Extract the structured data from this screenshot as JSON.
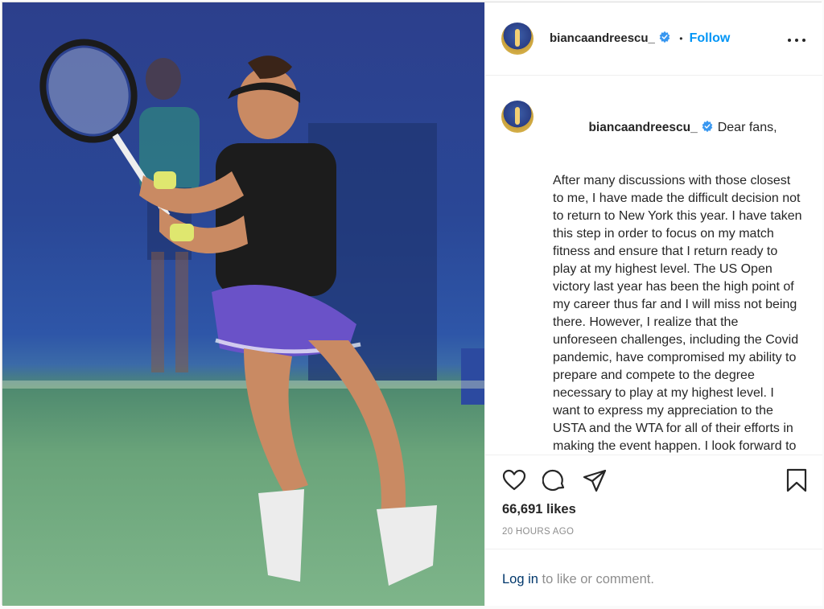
{
  "post": {
    "username": "biancaandreescu_",
    "follow_label": "Follow",
    "separator": "•",
    "caption_greeting": "Dear fans,",
    "caption_body": "After many discussions with those closest to me, I have made the difficult decision not to return to New York this year. I have taken this step in order to focus on my match fitness and ensure that I return ready to play at my highest level. The US Open victory last year has been the high point of my career thus far and I will miss not being there. However, I realize that the unforeseen challenges, including the Covid pandemic, have compromised my ability to prepare and compete to the degree necessary to play at my highest level. I want to express my appreciation to the USTA and the WTA for all of their efforts in making the event happen. I look forward to",
    "likes": "66,691 likes",
    "timestamp": "20 HOURS AGO",
    "login_link": "Log in",
    "login_suffix": " to like or comment."
  },
  "icons": {
    "verified": "verified-badge-icon",
    "more": "more-options-icon",
    "like": "heart-icon",
    "comment": "comment-icon",
    "share": "share-icon",
    "save": "bookmark-icon"
  },
  "colors": {
    "accent": "#0095f6",
    "link": "#00376b",
    "muted": "#8e8e8e",
    "text": "#262626",
    "border": "#dbdbdb"
  }
}
